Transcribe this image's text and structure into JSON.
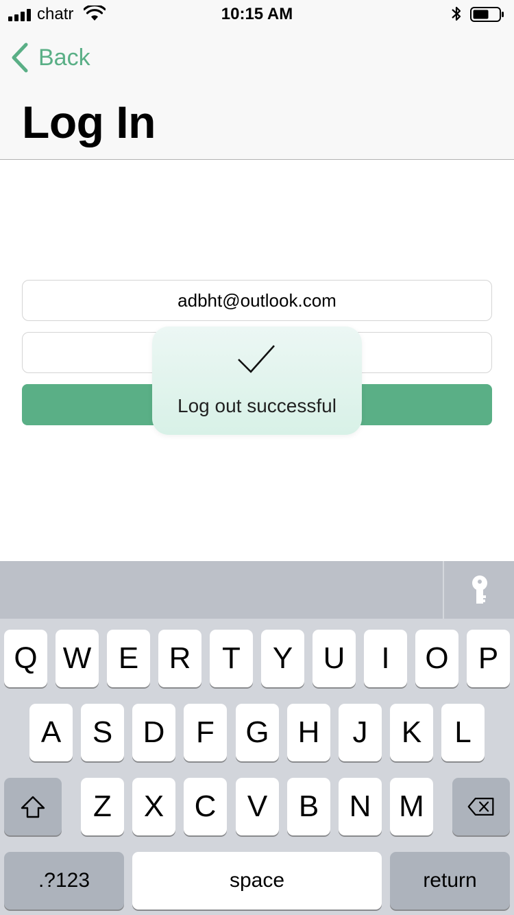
{
  "status_bar": {
    "carrier": "chatr",
    "time": "10:15 AM"
  },
  "navbar": {
    "back_label": "Back",
    "title": "Log In"
  },
  "form": {
    "email_value": "adbht@outlook.com",
    "password_value": ""
  },
  "toast": {
    "message": "Log out successful",
    "icon": "checkmark-icon"
  },
  "keyboard": {
    "row1": [
      "Q",
      "W",
      "E",
      "R",
      "T",
      "Y",
      "U",
      "I",
      "O",
      "P"
    ],
    "row2": [
      "A",
      "S",
      "D",
      "F",
      "G",
      "H",
      "J",
      "K",
      "L"
    ],
    "row3": [
      "Z",
      "X",
      "C",
      "V",
      "B",
      "N",
      "M"
    ],
    "numbers_label": ".?123",
    "space_label": "space",
    "return_label": "return"
  },
  "colors": {
    "accent": "#5aaf86",
    "toast_bg": "#dff4ec"
  }
}
